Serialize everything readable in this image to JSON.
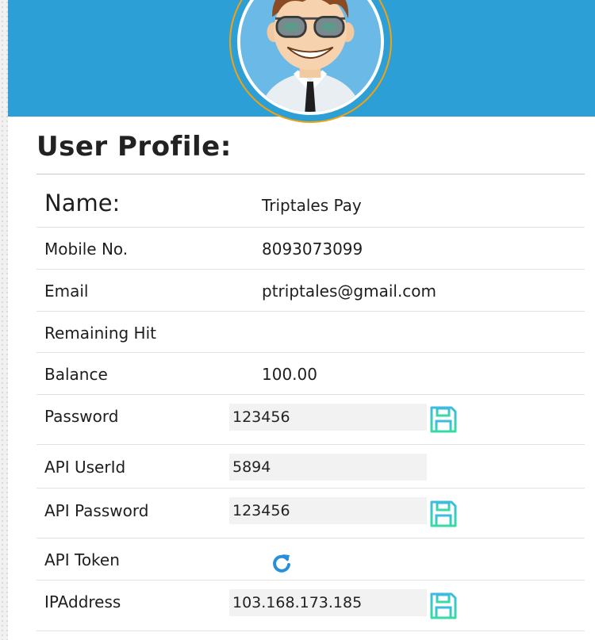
{
  "profile": {
    "title": "User Profile:",
    "avatar_icon": "cartoon-man-with-sunglasses-avatar",
    "rows": [
      {
        "label": "Name:",
        "value": "Triptales Pay"
      },
      {
        "label": "Mobile No.",
        "value": "8093073099"
      },
      {
        "label": "Email",
        "value": "ptriptales@gmail.com"
      },
      {
        "label": "Remaining Hit",
        "value": ""
      },
      {
        "label": "Balance",
        "value": "100.00"
      },
      {
        "label": "Password",
        "value": "123456",
        "action_icon": "save-icon"
      },
      {
        "label": "API UserId",
        "value": "5894"
      },
      {
        "label": "API Password",
        "value": "123456",
        "action_icon": "save-icon"
      },
      {
        "label": "API Token",
        "action_icon": "refresh-icon"
      },
      {
        "label": "IPAddress",
        "value": "103.168.173.185",
        "action_icon": "save-icon"
      }
    ]
  },
  "colors": {
    "banner": "#2c9fd6",
    "avatar_ring": "#f1a20f",
    "save_icon_gradient": [
      "#3dbbe0",
      "#37dba3"
    ],
    "refresh_icon": "#2a8fd8"
  }
}
